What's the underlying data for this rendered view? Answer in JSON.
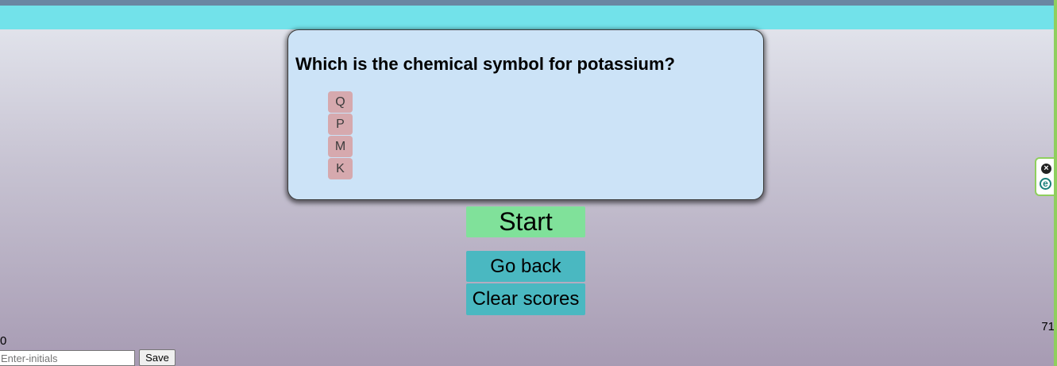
{
  "quiz": {
    "question": "Which is the chemical symbol for potassium?",
    "choices": [
      "Q",
      "P",
      "M",
      "K"
    ]
  },
  "buttons": {
    "start_label": "Start",
    "go_back_label": "Go back",
    "clear_scores_label": "Clear scores",
    "save_label": "Save"
  },
  "score_display": "0",
  "timer": "71",
  "initials_input": {
    "value": "",
    "placeholder": "Enter-initials"
  },
  "extension": {
    "close_icon": "close-icon",
    "logo_icon": "e-logo-icon",
    "logo_glyph": "e"
  },
  "colors": {
    "header_bar": "#72e2ea",
    "card_background": "#cce3f7",
    "choice_background": "#d6a9ae",
    "start_button": "#80e19a",
    "secondary_buttons": "#4ab8c1"
  }
}
